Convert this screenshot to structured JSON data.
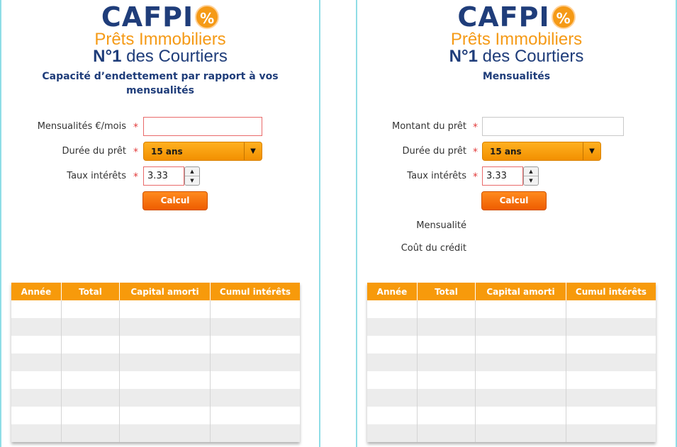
{
  "brand": {
    "name": "CAFPI",
    "badge": "%",
    "tagline": "Prêts Immobiliers",
    "tagline2_strong": "N°1",
    "tagline2_rest": " des Courtiers"
  },
  "panels": [
    {
      "title": "Capacité d’endettement par rapport à vos mensualités",
      "fields": {
        "amount_label": "Mensualités €/mois",
        "amount_value": "",
        "duration_label": "Durée du prêt",
        "duration_value": "15 ans",
        "rate_label": "Taux intérêts",
        "rate_value": "3.33",
        "required_mark": "*"
      },
      "button": "Calcul",
      "table": {
        "headers": [
          "Année",
          "Total",
          "Capital amorti",
          "Cumul intérêts"
        ]
      }
    },
    {
      "title": "Mensualités",
      "fields": {
        "amount_label": "Montant du prêt",
        "amount_value": "",
        "duration_label": "Durée du prêt",
        "duration_value": "15 ans",
        "rate_label": "Taux intérêts",
        "rate_value": "3.33",
        "required_mark": "*"
      },
      "button": "Calcul",
      "results": {
        "monthly_label": "Mensualité",
        "cost_label": "Coût du crédit"
      },
      "table": {
        "headers": [
          "Année",
          "Total",
          "Capital amorti",
          "Cumul intérêts"
        ]
      }
    }
  ],
  "colors": {
    "accent": "#f79a0b",
    "brand_blue": "#1f3d7a",
    "button": "#ee5d00",
    "frame": "#8fdde6"
  }
}
